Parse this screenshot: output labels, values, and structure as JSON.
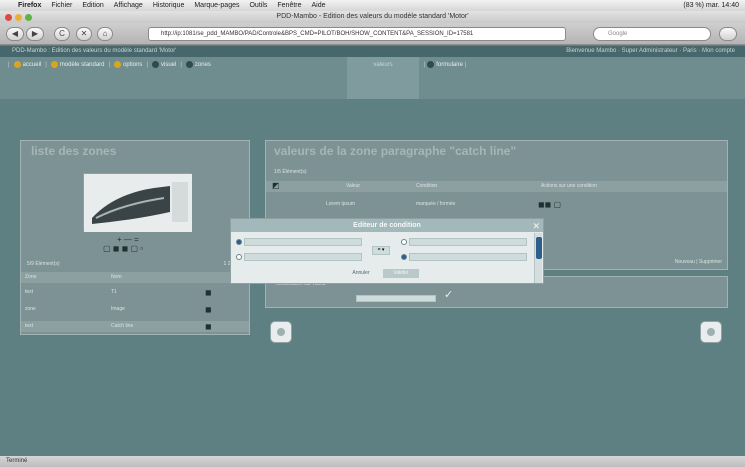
{
  "menubar": {
    "apple": "",
    "app": "Firefox",
    "items": [
      "Fichier",
      "Edition",
      "Affichage",
      "Historique",
      "Marque-pages",
      "Outils",
      "Fenêtre",
      "Aide"
    ],
    "clock": "(83 %) mar. 14:40"
  },
  "window": {
    "title": "PDD-Mambo - Edition des valeurs du modèle standard 'Motor'"
  },
  "toolbar": {
    "back": "◀",
    "forward": "▶",
    "reload": "C",
    "stop": "✕",
    "home": "⌂",
    "url": "http://ip:1081/se_pdd_MAMBO/PAD/Controle&BPS_CMD=PILOT/BOH/SHOW_CONTENT&PA_SESSION_ID=17581",
    "search_placeholder": "Google"
  },
  "app_header": {
    "left": "PDD-Mambo : Edition des valeurs du modèle standard 'Motor'",
    "right": "Bienvenue Mambo · Super Administrateur · Paris · Mon compte"
  },
  "nav": {
    "items": [
      {
        "label": "accueil"
      },
      {
        "label": "modèle standard"
      },
      {
        "label": "options"
      },
      {
        "label": "visuel"
      },
      {
        "label": "zones"
      }
    ],
    "selected": "valeurs",
    "last": "formulaire"
  },
  "left_panel": {
    "title": "liste des zones",
    "count_label": "5/9 Élément(s)",
    "pager": "1 2 3 4 5",
    "columns": [
      "Zone",
      "Nom"
    ],
    "rows": [
      {
        "zone": "text",
        "name": "T1"
      },
      {
        "zone": "zone",
        "name": "Image"
      },
      {
        "zone": "text",
        "name": "Catch line"
      }
    ]
  },
  "right_panel": {
    "title": "valeurs de la zone paragraphe \"catch line\"",
    "count_label": "1/5 Élément(s)",
    "columns": [
      "Valeur",
      "Condition",
      "Actions sur une condition"
    ],
    "rows": [
      {
        "value": "Lorem ipsum",
        "condition": "marquée / formée"
      }
    ],
    "buttons": [
      "Nouveau",
      "Supprimer"
    ],
    "edit_label": "Modification sur valeur"
  },
  "dialog": {
    "title": "Editeur de condition",
    "op": "= ▾",
    "cancel": "Annuler",
    "ok": "Valider"
  },
  "status": {
    "text": "Terminé"
  }
}
